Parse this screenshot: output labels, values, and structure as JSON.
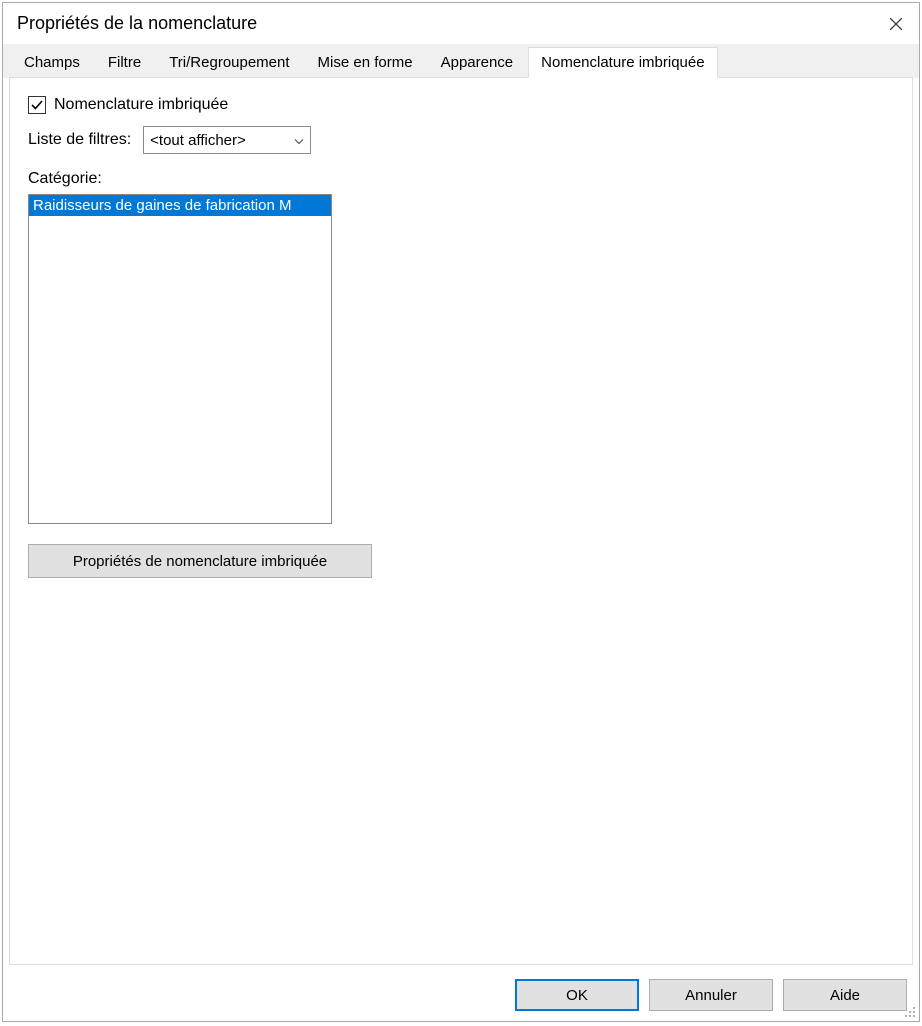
{
  "window": {
    "title": "Propriétés de la nomenclature"
  },
  "tabs": [
    {
      "label": "Champs"
    },
    {
      "label": "Filtre"
    },
    {
      "label": "Tri/Regroupement"
    },
    {
      "label": "Mise en forme"
    },
    {
      "label": "Apparence"
    },
    {
      "label": "Nomenclature imbriquée",
      "active": true
    }
  ],
  "panel": {
    "checkbox_label": "Nomenclature imbriquée",
    "checkbox_checked": true,
    "filter_label": "Liste de filtres:",
    "filter_value": "<tout afficher>",
    "category_label": "Catégorie:",
    "category_items": [
      {
        "text": "Raidisseurs de gaines de fabrication M",
        "selected": true
      }
    ],
    "props_button": "Propriétés de nomenclature imbriquée"
  },
  "footer": {
    "ok": "OK",
    "cancel": "Annuler",
    "help": "Aide"
  }
}
